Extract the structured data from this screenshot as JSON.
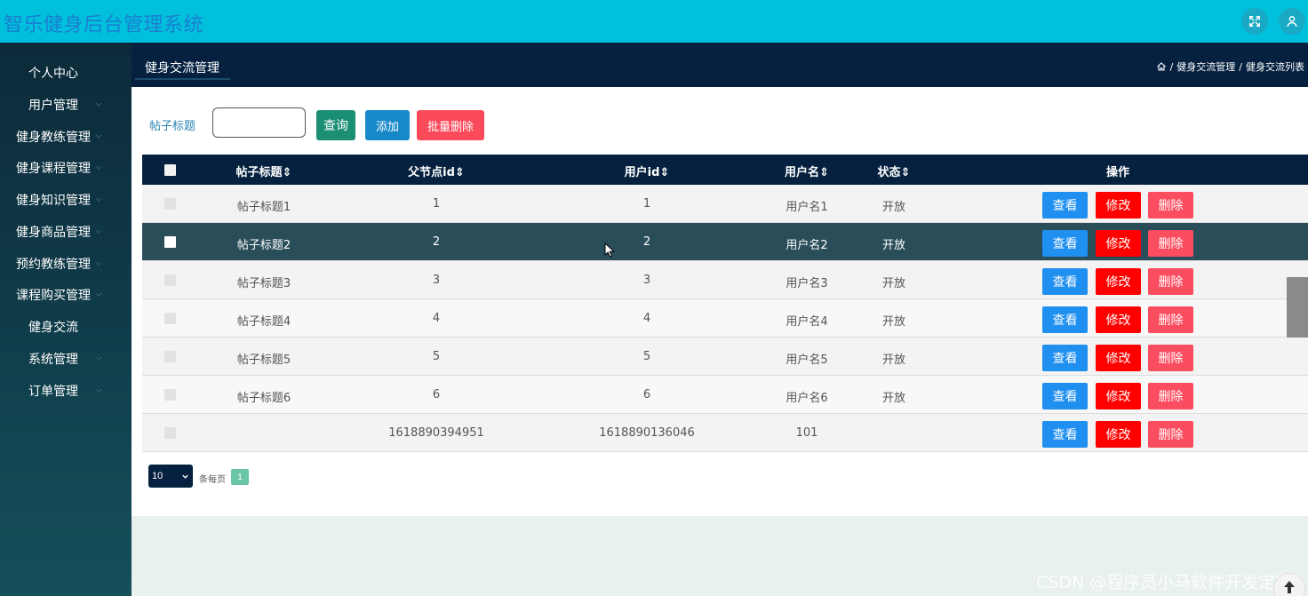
{
  "app": {
    "title": "智乐健身后台管理系统"
  },
  "topbar": {
    "icons": [
      "fullscreen-icon",
      "user-icon"
    ]
  },
  "sidebar": {
    "items": [
      {
        "label": "个人中心",
        "has_chevron": false
      },
      {
        "label": "用户管理",
        "has_chevron": true
      },
      {
        "label": "健身教练管理",
        "has_chevron": true
      },
      {
        "label": "健身课程管理",
        "has_chevron": true
      },
      {
        "label": "健身知识管理",
        "has_chevron": true
      },
      {
        "label": "健身商品管理",
        "has_chevron": true
      },
      {
        "label": "预约教练管理",
        "has_chevron": true
      },
      {
        "label": "课程购买管理",
        "has_chevron": true
      },
      {
        "label": "健身交流",
        "has_chevron": false
      },
      {
        "label": "系统管理",
        "has_chevron": true
      },
      {
        "label": "订单管理",
        "has_chevron": true
      }
    ]
  },
  "header": {
    "title": "健身交流管理",
    "breadcrumb": [
      "健身交流管理",
      "健身交流列表"
    ],
    "breadcrumb_sep": "/"
  },
  "search": {
    "label": "帖子标题",
    "value": "",
    "query_label": "查询",
    "add_label": "添加",
    "batch_delete_label": "批量删除"
  },
  "table": {
    "columns": [
      "帖子标题",
      "父节点id",
      "用户id",
      "用户名",
      "状态",
      "操作"
    ],
    "rows": [
      {
        "title": "帖子标题1",
        "parent_id": "1",
        "user_id": "1",
        "username": "用户名1",
        "status": "开放"
      },
      {
        "title": "帖子标题2",
        "parent_id": "2",
        "user_id": "2",
        "username": "用户名2",
        "status": "开放"
      },
      {
        "title": "帖子标题3",
        "parent_id": "3",
        "user_id": "3",
        "username": "用户名3",
        "status": "开放"
      },
      {
        "title": "帖子标题4",
        "parent_id": "4",
        "user_id": "4",
        "username": "用户名4",
        "status": "开放"
      },
      {
        "title": "帖子标题5",
        "parent_id": "5",
        "user_id": "5",
        "username": "用户名5",
        "status": "开放"
      },
      {
        "title": "帖子标题6",
        "parent_id": "6",
        "user_id": "6",
        "username": "用户名6",
        "status": "开放"
      },
      {
        "title": "",
        "parent_id": "1618890394951",
        "user_id": "1618890136046",
        "username": "101",
        "status": ""
      }
    ],
    "highlighted_row": 2,
    "actions": {
      "view": "查看",
      "edit": "修改",
      "delete": "删除"
    }
  },
  "pagination": {
    "page_size": "10",
    "per_page_label": "条每页",
    "current_page": "1"
  },
  "watermark": "CSDN @程序员小马软件开发定制",
  "colors": {
    "topbar": "#00c0dd",
    "sidebar": "#0c2a3a",
    "header": "#05213f",
    "query": "#1a8f73",
    "add": "#1789c8",
    "batch_delete": "#fb4a5a",
    "view": "#1f8ff0",
    "edit": "#ff0000",
    "delete": "#fb4d60",
    "highlight_row": "#2a4d5a"
  }
}
